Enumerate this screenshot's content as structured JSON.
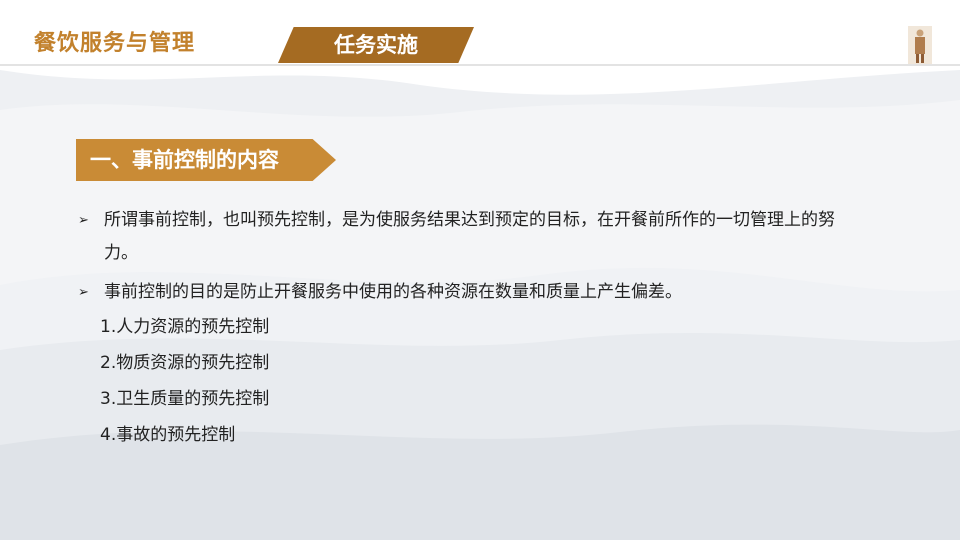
{
  "header": {
    "course_title": "餐饮服务与管理",
    "task_tab_label": "任务实施",
    "corner_image": "chef-figure-icon"
  },
  "section": {
    "title": "一、事前控制的内容"
  },
  "bullets": [
    {
      "marker": "➢",
      "text": "所谓事前控制，也叫预先控制，是为使服务结果达到预定的目标，在开餐前所作的一切管理上的努力。"
    },
    {
      "marker": "➢",
      "text": "事前控制的目的是防止开餐服务中使用的各种资源在数量和质量上产生偏差。"
    }
  ],
  "numbered_items": [
    "1.人力资源的预先控制",
    "2.物质资源的预先控制",
    "3.卫生质量的预先控制",
    "4.事故的预先控制"
  ],
  "colors": {
    "course_title": "#c2812c",
    "task_tab": "#a56b22",
    "section_banner": "#c98b36",
    "body_text": "#222222"
  }
}
